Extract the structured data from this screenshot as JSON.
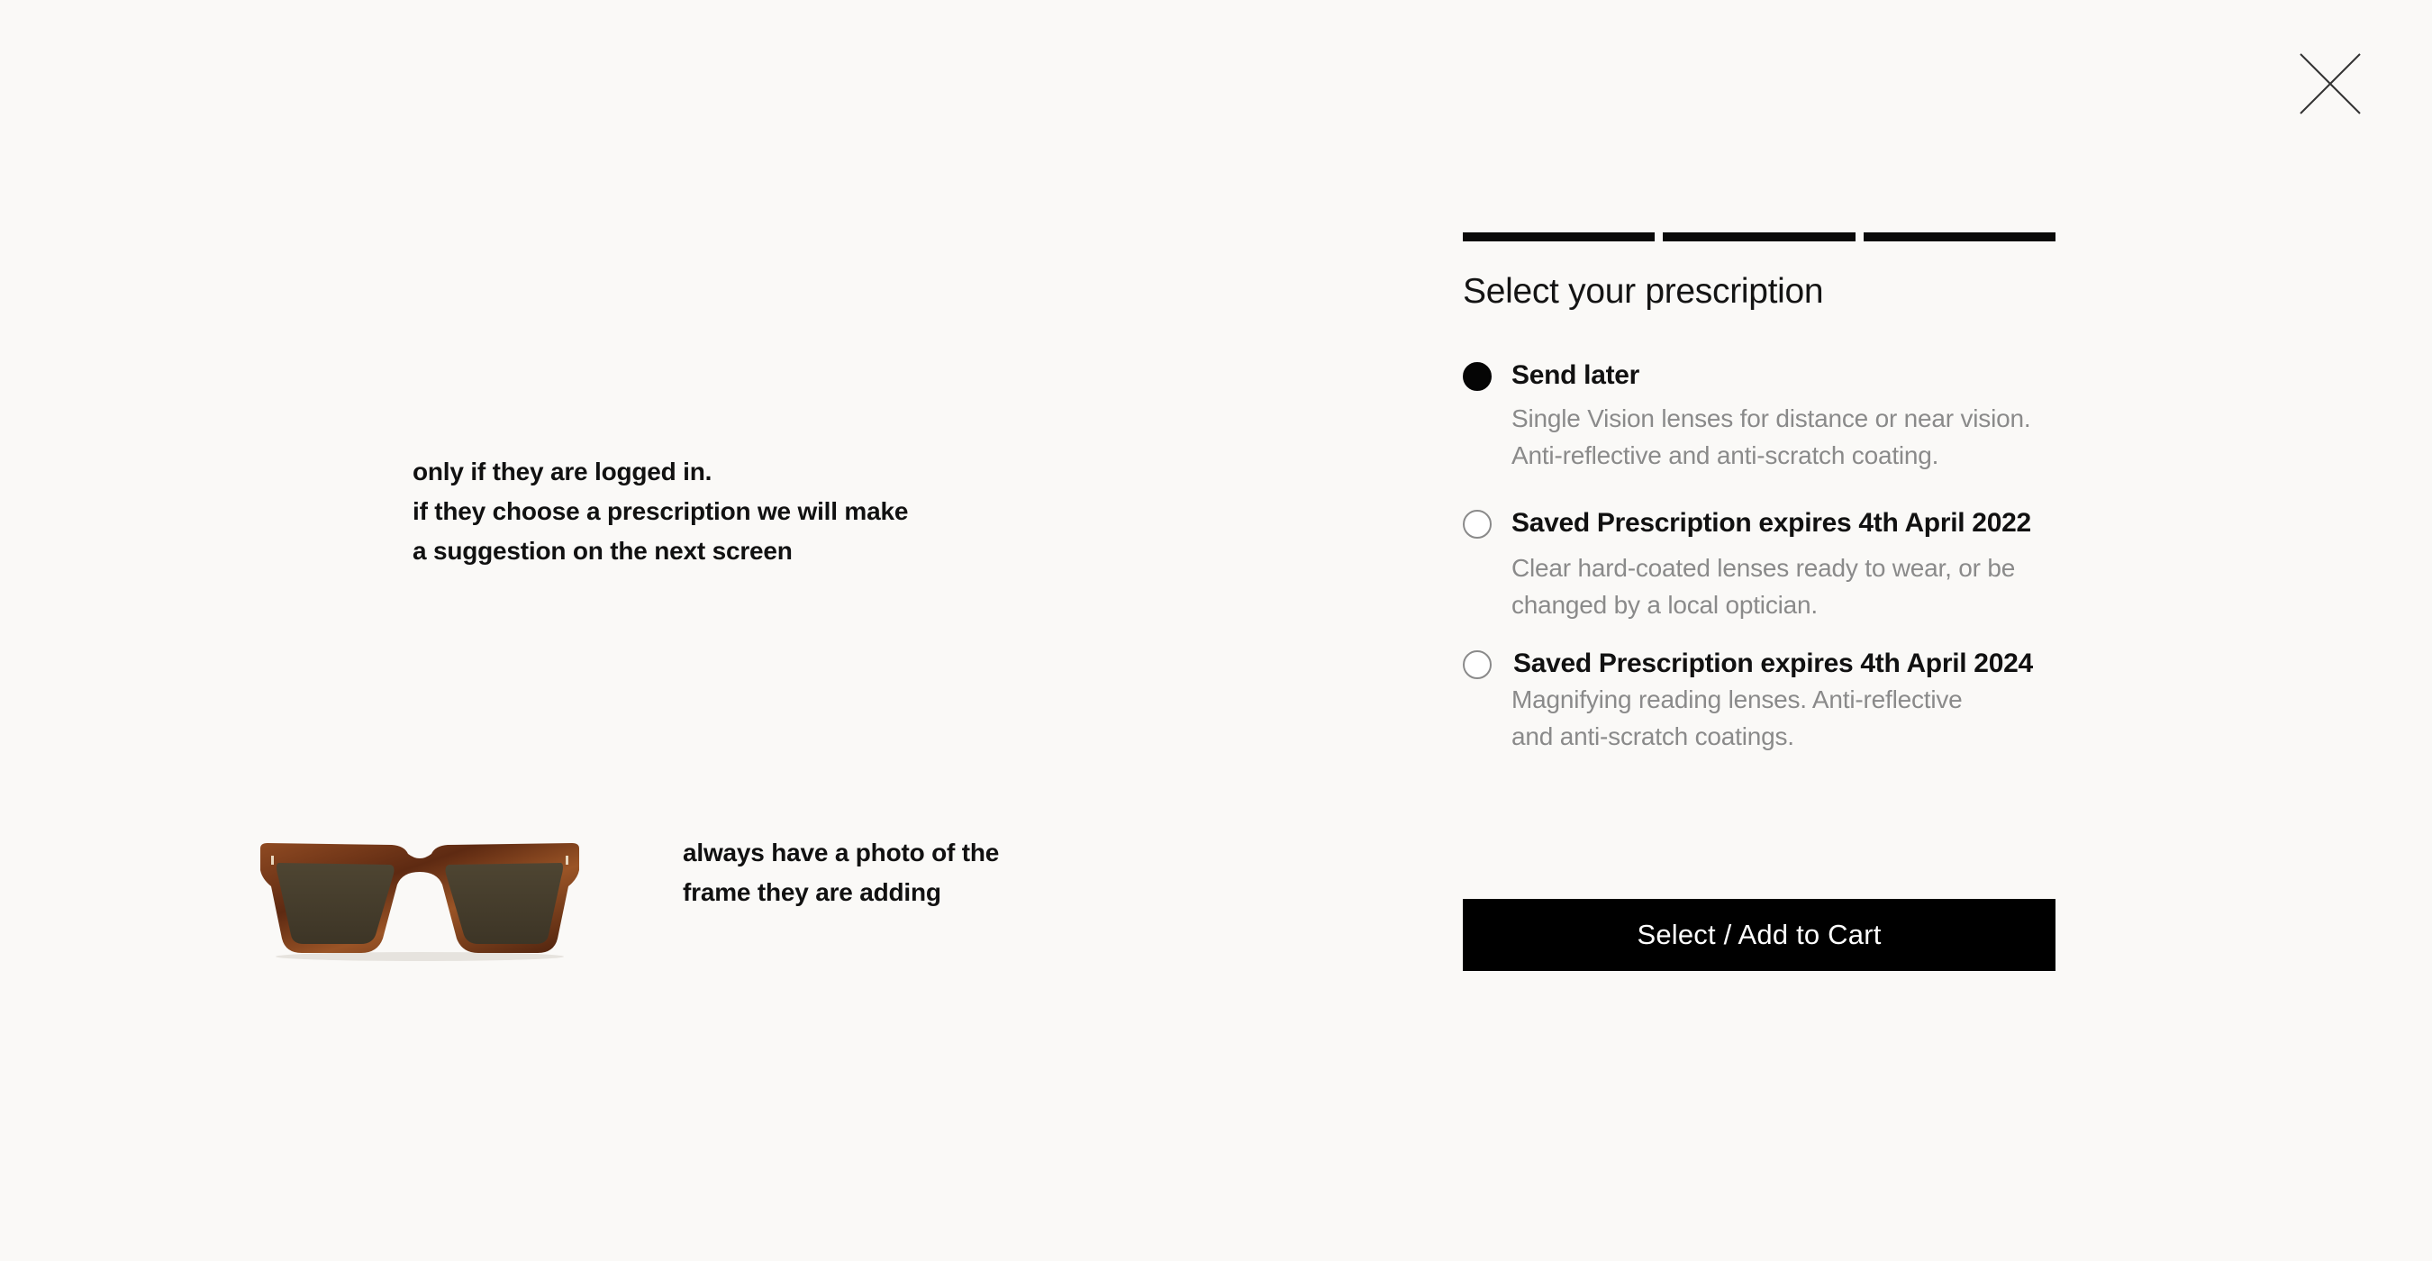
{
  "annotations": {
    "top_note": [
      "only if they are logged in.",
      "if they choose a prescription we will make",
      "a suggestion on the next screen"
    ],
    "bottom_note": [
      "always have a photo of the",
      "frame they are adding"
    ]
  },
  "product": {
    "image_icon": "sunglasses-tortoise-frame"
  },
  "modal": {
    "close_icon": "close-icon",
    "progress_steps": 3,
    "progress_completed": 3,
    "title": "Select your prescription",
    "options": [
      {
        "label": "Send later",
        "selected": true,
        "description": [
          "Single Vision lenses for distance or near vision.",
          "Anti-reflective and anti-scratch coating."
        ]
      },
      {
        "label": "Saved Prescription expires 4th April 2022",
        "selected": false,
        "description": [
          "Clear hard-coated lenses ready to wear, or be",
          "changed by a local optician."
        ]
      },
      {
        "label": "Saved Prescription expires 4th April 2024",
        "selected": false,
        "description": [
          "Magnifying reading lenses. Anti-reflective",
          "and anti-scratch coatings."
        ]
      }
    ],
    "cta_label": "Select / Add to Cart"
  },
  "colors": {
    "background": "#faf9f7",
    "accent": "#000000",
    "muted_text": "#8a8a8a",
    "frame_tortoise": "#7a3a1c",
    "lens": "#4a4130"
  }
}
